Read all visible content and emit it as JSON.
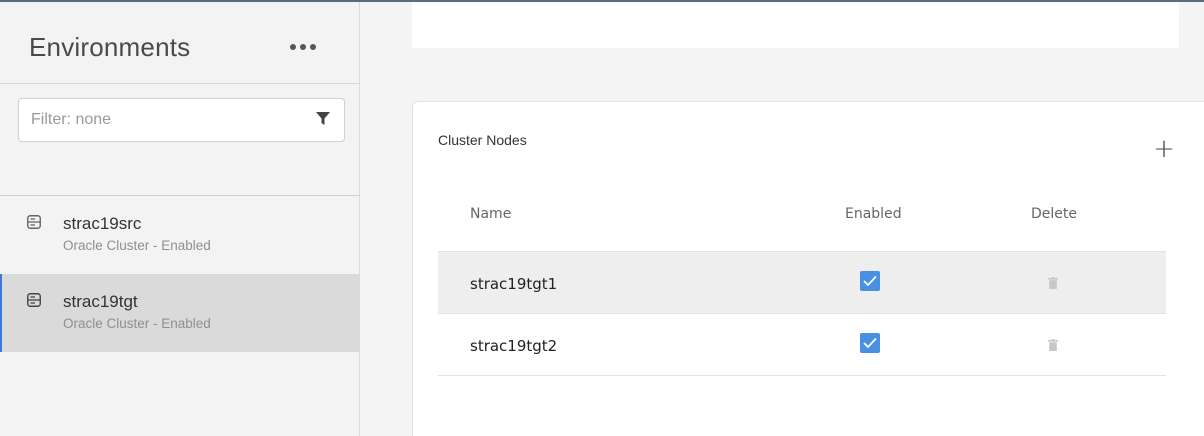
{
  "sidebar": {
    "title": "Environments",
    "more_icon": "more-horizontal-icon",
    "filter": {
      "placeholder": "Filter: none",
      "value": "",
      "icon": "filter-funnel-icon"
    },
    "items": [
      {
        "name": "strac19src",
        "subtitle": "Oracle Cluster - Enabled",
        "icon": "server-icon",
        "selected": false
      },
      {
        "name": "strac19tgt",
        "subtitle": "Oracle Cluster - Enabled",
        "icon": "server-icon",
        "selected": true
      }
    ]
  },
  "cluster_nodes": {
    "title": "Cluster Nodes",
    "add_icon": "plus-icon",
    "columns": {
      "name": "Name",
      "enabled": "Enabled",
      "delete": "Delete"
    },
    "rows": [
      {
        "name": "strac19tgt1",
        "enabled": true
      },
      {
        "name": "strac19tgt2",
        "enabled": true
      }
    ]
  },
  "colors": {
    "accent": "#4a90e2",
    "selected_bg": "#dadada",
    "selected_border": "#3a7bd5"
  }
}
